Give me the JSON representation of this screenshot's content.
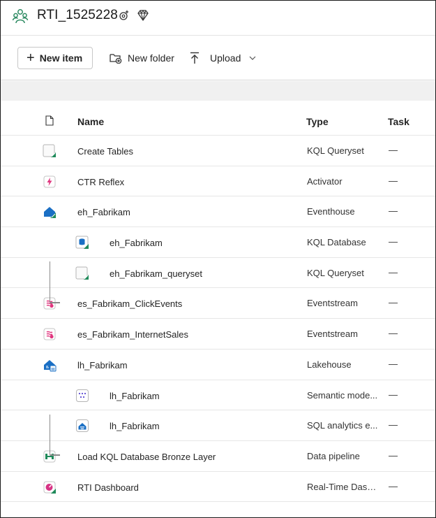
{
  "workspace": {
    "title": "RTI_1525228",
    "icons": [
      "workspace-people-icon",
      "settings-sparkle-icon",
      "premium-diamond-icon"
    ]
  },
  "toolbar": {
    "new_item_label": "New item",
    "new_folder_label": "New folder",
    "upload_label": "Upload"
  },
  "table": {
    "columns": {
      "name": "Name",
      "type": "Type",
      "task": "Task"
    },
    "rows": [
      {
        "name": "Create Tables",
        "type": "KQL Queryset",
        "task": "—",
        "icon": "kql-queryset-icon",
        "child": false
      },
      {
        "name": "CTR Reflex",
        "type": "Activator",
        "task": "—",
        "icon": "activator-icon",
        "child": false
      },
      {
        "name": "eh_Fabrikam",
        "type": "Eventhouse",
        "task": "—",
        "icon": "eventhouse-icon",
        "child": false
      },
      {
        "name": "eh_Fabrikam",
        "type": "KQL Database",
        "task": "—",
        "icon": "kql-database-icon",
        "child": true
      },
      {
        "name": "eh_Fabrikam_queryset",
        "type": "KQL Queryset",
        "task": "—",
        "icon": "kql-queryset-icon",
        "child": true
      },
      {
        "name": "es_Fabrikam_ClickEvents",
        "type": "Eventstream",
        "task": "—",
        "icon": "eventstream-icon",
        "child": false
      },
      {
        "name": "es_Fabrikam_InternetSales",
        "type": "Eventstream",
        "task": "—",
        "icon": "eventstream-icon",
        "child": false
      },
      {
        "name": "lh_Fabrikam",
        "type": "Lakehouse",
        "task": "—",
        "icon": "lakehouse-icon",
        "child": false
      },
      {
        "name": "lh_Fabrikam",
        "type": "Semantic mode...",
        "task": "—",
        "icon": "semantic-model-icon",
        "child": true
      },
      {
        "name": "lh_Fabrikam",
        "type": "SQL analytics e...",
        "task": "—",
        "icon": "sql-endpoint-icon",
        "child": true
      },
      {
        "name": "Load KQL Database Bronze Layer",
        "type": "Data pipeline",
        "task": "—",
        "icon": "data-pipeline-icon",
        "child": false
      },
      {
        "name": "RTI Dashboard",
        "type": "Real-Time Dash...",
        "task": "—",
        "icon": "realtime-dashboard-icon",
        "child": false
      }
    ]
  },
  "colors": {
    "accent_green": "#1f8a5a",
    "pink": "#d63384",
    "blue": "#1a6fc4",
    "band": "#f0f0f0"
  }
}
